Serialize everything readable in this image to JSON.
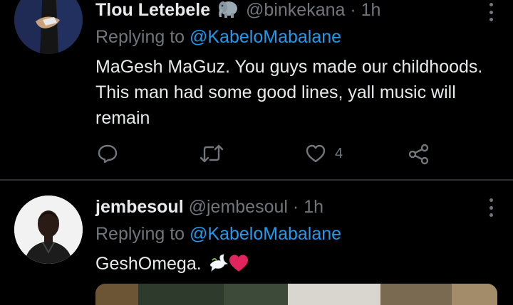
{
  "tweets": [
    {
      "name": "Tlou Letebele",
      "handle": "@binkekana",
      "separator": "·",
      "time": "1h",
      "replying_prefix": "Replying to",
      "replying_to": "@KabeloMabalane",
      "text": "MaGesh MaGuz. You guys made our childhoods. This man had some good lines, yall music will remain",
      "like_count": "4"
    },
    {
      "name": "jembesoul",
      "handle": "@jembesoul",
      "separator": "·",
      "time": "1h",
      "replying_prefix": "Replying to",
      "replying_to": "@KabeloMabalane",
      "text": "GeshOmega."
    }
  ],
  "colors": {
    "background": "#000000",
    "text": "#e7e9ea",
    "secondary": "#71767b",
    "link": "#1d9bf0",
    "divider": "#2f3336",
    "heart_emoji": "#e0245e"
  },
  "icons": [
    "elephant-emoji",
    "more-icon",
    "reply-icon",
    "retweet-icon",
    "like-icon",
    "share-icon",
    "dove-emoji",
    "heart-emoji"
  ]
}
